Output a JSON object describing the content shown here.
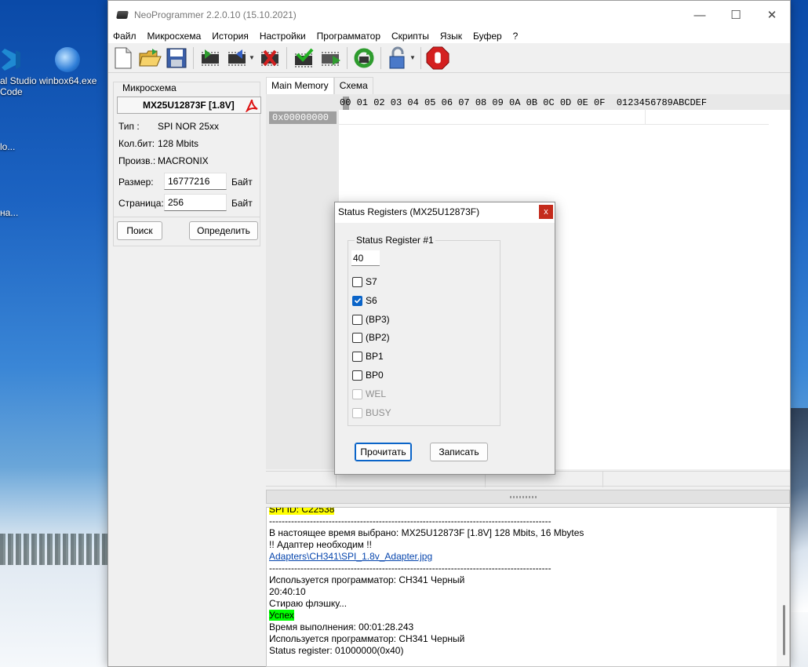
{
  "desktop": {
    "icons": [
      {
        "label1": "al Studio",
        "label2": "Code"
      },
      {
        "label1": "winbox64.exe"
      },
      {
        "label1": "lo..."
      },
      {
        "label1": "на..."
      }
    ]
  },
  "window": {
    "title": "NeoProgrammer 2.2.0.10 (15.10.2021)",
    "controls": {
      "minimize": "—",
      "maximize": "☐",
      "close": "✕"
    }
  },
  "menu": [
    "Файл",
    "Микросхема",
    "История",
    "Настройки",
    "Программатор",
    "Скрипты",
    "Язык",
    "Буфер",
    "?"
  ],
  "left_panel": {
    "group_title": "Микросхема",
    "chip_name": "MX25U12873F [1.8V]",
    "type_label": "Тип      :",
    "type_value": "SPI NOR 25xx",
    "bits_label": "Кол.бит:",
    "bits_value": "128 Mbits",
    "vendor_label": "Произв.:",
    "vendor_value": "MACRONIX",
    "size_label": "Размер:",
    "size_value": "16777216",
    "size_unit": "Байт",
    "page_label": "Страница:",
    "page_value": "256",
    "page_unit": "Байт",
    "search_button": "Поиск",
    "detect_button": "Определить"
  },
  "tabs": [
    "Main Memory",
    "Схема"
  ],
  "hex": {
    "header": "00 01 02 03 04 05 06 07 08 09 0A 0B 0C 0D 0E 0F  0123456789ABCDEF",
    "address": "0x00000000"
  },
  "log": {
    "lines": [
      {
        "text": "SPI ID: C22538",
        "style": "yellow"
      },
      {
        "text": "------------------------------------------------------------------------------------------",
        "style": "plain"
      },
      {
        "text": "В настоящее время выбрано:  MX25U12873F [1.8V] 128 Mbits, 16 Mbytes",
        "style": "plain"
      },
      {
        "text": "!! Адаптер необходим !!",
        "style": "plain"
      },
      {
        "text": "Adapters\\CH341\\SPI_1.8v_Adapter.jpg",
        "style": "link"
      },
      {
        "text": "------------------------------------------------------------------------------------------",
        "style": "plain"
      },
      {
        "text": "Используется программатор: CH341 Черный",
        "style": "plain"
      },
      {
        "text": "20:40:10",
        "style": "plain"
      },
      {
        "text": "Стираю флэшку...",
        "style": "plain"
      },
      {
        "text": "Успех",
        "style": "green"
      },
      {
        "text": "Время выполнения: 00:01:28.243",
        "style": "plain"
      },
      {
        "text": "Используется программатор: CH341 Черный",
        "style": "plain"
      },
      {
        "text": "Status register:  01000000(0x40)",
        "style": "plain"
      }
    ]
  },
  "dialog": {
    "title": "Status Registers (MX25U12873F)",
    "close": "x",
    "group_title": "Status Register #1",
    "register_value": "40",
    "bits": [
      {
        "label": "S7",
        "checked": false,
        "enabled": true
      },
      {
        "label": "S6",
        "checked": true,
        "enabled": true
      },
      {
        "label": "(BP3)",
        "checked": false,
        "enabled": true
      },
      {
        "label": "(BP2)",
        "checked": false,
        "enabled": true
      },
      {
        "label": "BP1",
        "checked": false,
        "enabled": true
      },
      {
        "label": "BP0",
        "checked": false,
        "enabled": true
      },
      {
        "label": "WEL",
        "checked": false,
        "enabled": false
      },
      {
        "label": "BUSY",
        "checked": false,
        "enabled": false
      }
    ],
    "read_button": "Прочитать",
    "write_button": "Записать"
  },
  "colors": {
    "accent": "#0a64c8",
    "close_red": "#c42b1c",
    "log_yellow": "#ffff00",
    "log_green": "#00ff00"
  }
}
